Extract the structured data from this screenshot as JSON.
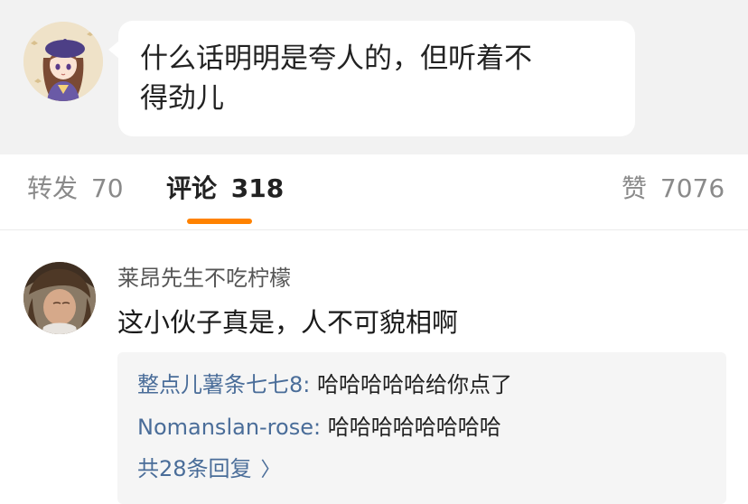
{
  "post": {
    "text": "什么话明明是夸人的，但听着不\n得劲儿"
  },
  "tabs": [
    {
      "label": "转发",
      "count": "70"
    },
    {
      "label": "评论",
      "count": "318"
    },
    {
      "label": "赞",
      "count": "7076"
    }
  ],
  "comment": {
    "username": "莱昂先生不吃柠檬",
    "text": "这小伙子真是，人不可貌相啊",
    "replies": [
      {
        "name": "整点儿薯条七七8:",
        "text": " 哈哈哈哈哈给你点了"
      },
      {
        "name": "Nomanslan-rose:",
        "text": " 哈哈哈哈哈哈哈哈"
      }
    ],
    "more_label": "共28条回复",
    "more_icon": "chevron-right-icon"
  },
  "colors": {
    "accent": "#ff8200",
    "link": "#4a6d99",
    "post_bg": "#f2f2f2",
    "reply_bg": "#f5f5f5"
  }
}
